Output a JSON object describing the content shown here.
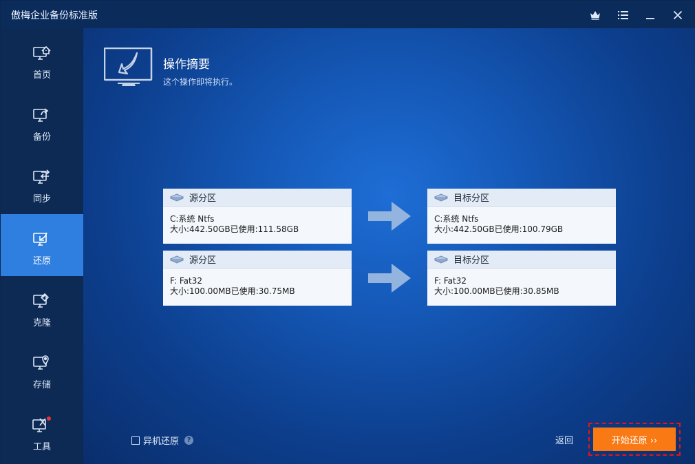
{
  "window": {
    "title": "傲梅企业备份标准版"
  },
  "sidebar": {
    "items": [
      {
        "label": "首页",
        "icon": "home-monitor-icon"
      },
      {
        "label": "备份",
        "icon": "backup-monitor-icon"
      },
      {
        "label": "同步",
        "icon": "sync-monitor-icon"
      },
      {
        "label": "还原",
        "icon": "restore-monitor-icon",
        "active": true
      },
      {
        "label": "克隆",
        "icon": "clone-monitor-icon"
      },
      {
        "label": "存储",
        "icon": "storage-location-icon"
      },
      {
        "label": "工具",
        "icon": "tools-monitor-icon"
      }
    ]
  },
  "header": {
    "title": "操作摘要",
    "subtitle": "这个操作即将执行。"
  },
  "rows": [
    {
      "source": {
        "head": "源分区",
        "line1": "C:系统 Ntfs",
        "line2": "大小:442.50GB已使用:111.58GB"
      },
      "target": {
        "head": "目标分区",
        "line1": "C:系统 Ntfs",
        "line2": "大小:442.50GB已使用:100.79GB"
      }
    },
    {
      "source": {
        "head": "源分区",
        "line1": "F: Fat32",
        "line2": "大小:100.00MB已使用:30.75MB"
      },
      "target": {
        "head": "目标分区",
        "line1": "F: Fat32",
        "line2": "大小:100.00MB已使用:30.85MB"
      }
    }
  ],
  "footer": {
    "checkbox_label": "异机还原",
    "help_glyph": "?",
    "back_label": "返回",
    "start_label": "开始还原 ››"
  },
  "colors": {
    "accent": "#2f7fe0",
    "primary_button": "#f97a14",
    "highlight_border": "#e4141a",
    "notification_dot": "#e8343a"
  }
}
